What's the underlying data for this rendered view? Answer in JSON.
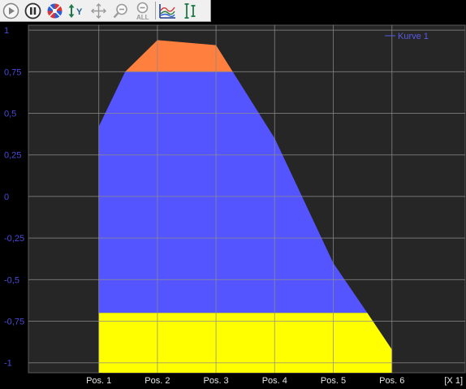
{
  "toolbar": {
    "buttons": [
      {
        "name": "play-button",
        "icon": "play-icon"
      },
      {
        "name": "pause-button",
        "icon": "pause-icon"
      },
      {
        "name": "color-wheel-button",
        "icon": "color-wheel-icon"
      },
      {
        "name": "scale-y-button",
        "icon": "scale-y-icon"
      },
      {
        "name": "move-button",
        "icon": "move-icon"
      },
      {
        "name": "zoom-out-button",
        "icon": "zoom-out-icon"
      },
      {
        "name": "zoom-all-button",
        "icon": "zoom-all-icon"
      },
      {
        "name": "curves-button",
        "icon": "curves-icon"
      },
      {
        "name": "cursor-button",
        "icon": "cursor-icon"
      }
    ],
    "scale_y_label": "Y",
    "zoom_all_label": "ALL"
  },
  "colors": {
    "plot_bg": "#262626",
    "grid": "#8c8c8c",
    "axis_text_y": "#4a4ad8",
    "axis_text_x": "#e8e8e8",
    "band_top": "#ff7f3f",
    "band_mid": "#5555ff",
    "band_bottom": "#ffff00",
    "legend": "#5a5ae6"
  },
  "chart_data": {
    "type": "area",
    "x": [
      1,
      2,
      3,
      4,
      5,
      6
    ],
    "x_tick_labels": [
      "Pos. 1",
      "Pos. 2",
      "Pos. 3",
      "Pos. 4",
      "Pos. 5",
      "Pos. 6"
    ],
    "x_unit_label": "[X 1]",
    "xlim": [
      -0.2,
      7.25
    ],
    "ylim": [
      -1.06,
      1.03
    ],
    "y_ticks": [
      1,
      0.75,
      0.5,
      0.25,
      0,
      -0.25,
      -0.5,
      -0.75,
      -1
    ],
    "y_tick_labels": [
      "1",
      "0,75",
      "0,5",
      "0,25",
      "0",
      "-0,25",
      "-0,5",
      "-0,75",
      "-1"
    ],
    "grid": true,
    "legend": {
      "label": "Kurve 1",
      "position": "top-right"
    },
    "curve": {
      "x": [
        1,
        1.45,
        2,
        3,
        4,
        5,
        5.58,
        6
      ],
      "y": [
        0.42,
        0.75,
        0.94,
        0.91,
        0.35,
        -0.4,
        -0.7,
        -0.92
      ]
    },
    "bands": [
      {
        "name": "top",
        "from": 0.75,
        "to": 1.03,
        "color_key": "band_top"
      },
      {
        "name": "middle",
        "from": -0.7,
        "to": 0.75,
        "color_key": "band_mid"
      },
      {
        "name": "bottom",
        "from": -1.06,
        "to": -0.7,
        "color_key": "band_bottom"
      }
    ]
  }
}
